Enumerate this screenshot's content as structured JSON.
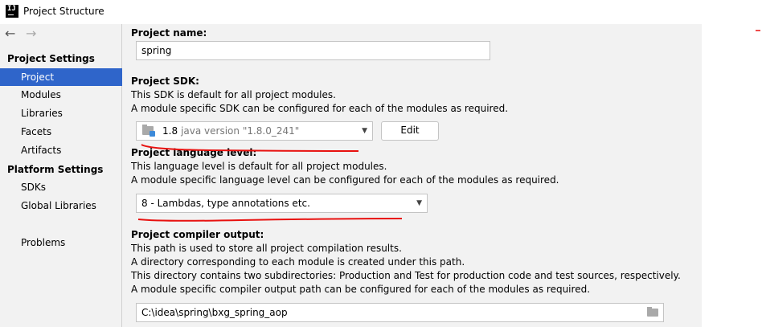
{
  "window": {
    "title": "Project Structure",
    "icon": "intellij-idea-icon"
  },
  "sidebar": {
    "back_icon": "←",
    "forward_icon": "→",
    "sections": [
      {
        "title": "Project Settings",
        "items": [
          "Project",
          "Modules",
          "Libraries",
          "Facets",
          "Artifacts"
        ]
      },
      {
        "title": "Platform Settings",
        "items": [
          "SDKs",
          "Global Libraries"
        ]
      }
    ],
    "selected": "Project",
    "problems": "Problems"
  },
  "project_name": {
    "label": "Project name:",
    "value": "spring"
  },
  "project_sdk": {
    "label": "Project SDK:",
    "desc1": "This SDK is default for all project modules.",
    "desc2": "A module specific SDK can be configured for each of the modules as required.",
    "version": "1.8",
    "detail": "java version \"1.8.0_241\"",
    "edit_label": "Edit"
  },
  "language_level": {
    "label": "Project language level:",
    "desc1": "This language level is default for all project modules.",
    "desc2": "A module specific language level can be configured for each of the modules as required.",
    "value": "8 - Lambdas, type annotations etc."
  },
  "compiler_output": {
    "label": "Project compiler output:",
    "desc1": "This path is used to store all project compilation results.",
    "desc2": "A directory corresponding to each module is created under this path.",
    "desc3": "This directory contains two subdirectories: Production and Test for production code and test sources, respectively.",
    "desc4": "A module specific compiler output path can be configured for each of the modules as required.",
    "value": "C:\\idea\\spring\\bxg_spring_aop"
  },
  "colors": {
    "selection": "#2f65ca",
    "annotation": "#e8110f",
    "panel_bg": "#f2f2f2"
  }
}
